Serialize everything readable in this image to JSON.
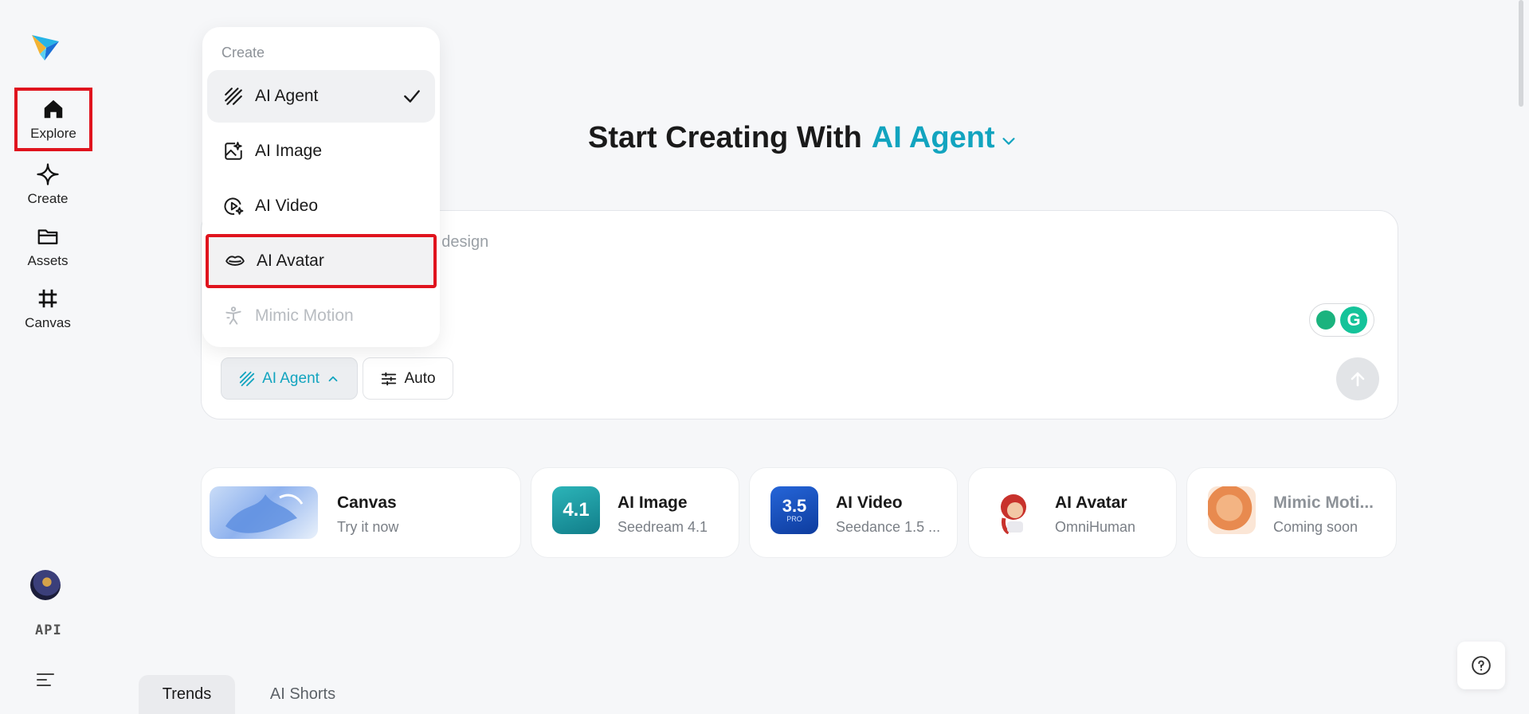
{
  "sidebar": {
    "items": [
      {
        "label": "Explore"
      },
      {
        "label": "Create"
      },
      {
        "label": "Assets"
      },
      {
        "label": "Canvas"
      }
    ],
    "api_label": "API"
  },
  "heading": {
    "prefix": "Start Creating With",
    "mode": "AI Agent"
  },
  "prompt": {
    "placeholder_visible": "ea, such as a holiday greeting design",
    "mode_button_label": "AI Agent",
    "auto_label": "Auto",
    "grammarly_letter": "G"
  },
  "dropdown": {
    "title": "Create",
    "items": [
      {
        "label": "AI Agent",
        "selected": true
      },
      {
        "label": "AI Image"
      },
      {
        "label": "AI Video"
      },
      {
        "label": "AI Avatar"
      },
      {
        "label": "Mimic Motion",
        "disabled": true
      }
    ]
  },
  "cards": [
    {
      "title": "Canvas",
      "subtitle": "Try it now"
    },
    {
      "title": "AI Image",
      "subtitle": "Seedream 4.1",
      "badge": "4.1"
    },
    {
      "title": "AI Video",
      "subtitle": "Seedance 1.5 ...",
      "badge": "3.5",
      "badge_sub": "PRO"
    },
    {
      "title": "AI Avatar",
      "subtitle": "OmniHuman"
    },
    {
      "title": "Mimic Moti...",
      "subtitle": "Coming soon"
    }
  ],
  "tabs": [
    {
      "label": "Trends",
      "active": true
    },
    {
      "label": "AI Shorts"
    }
  ],
  "colors": {
    "accent": "#12a4bf",
    "highlight": "#e0141e",
    "background": "#f6f7f9"
  }
}
